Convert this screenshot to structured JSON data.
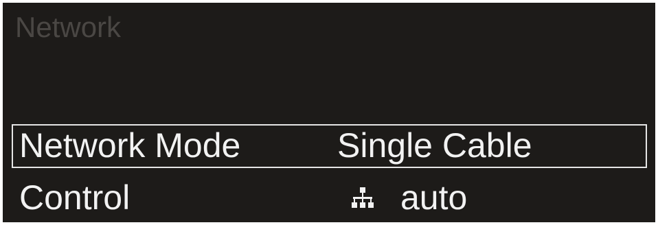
{
  "screen": {
    "title": "Network"
  },
  "menu": {
    "items": [
      {
        "label": "Network Mode",
        "value": "Single Cable",
        "selected": true
      },
      {
        "label": "Control",
        "value": "auto",
        "icon": "network-tree-icon",
        "selected": false
      }
    ]
  },
  "colors": {
    "background": "#1d1b19",
    "title_text": "#4a4744",
    "item_text": "#f2f2f2",
    "selection_border": "#e6e6e6"
  }
}
